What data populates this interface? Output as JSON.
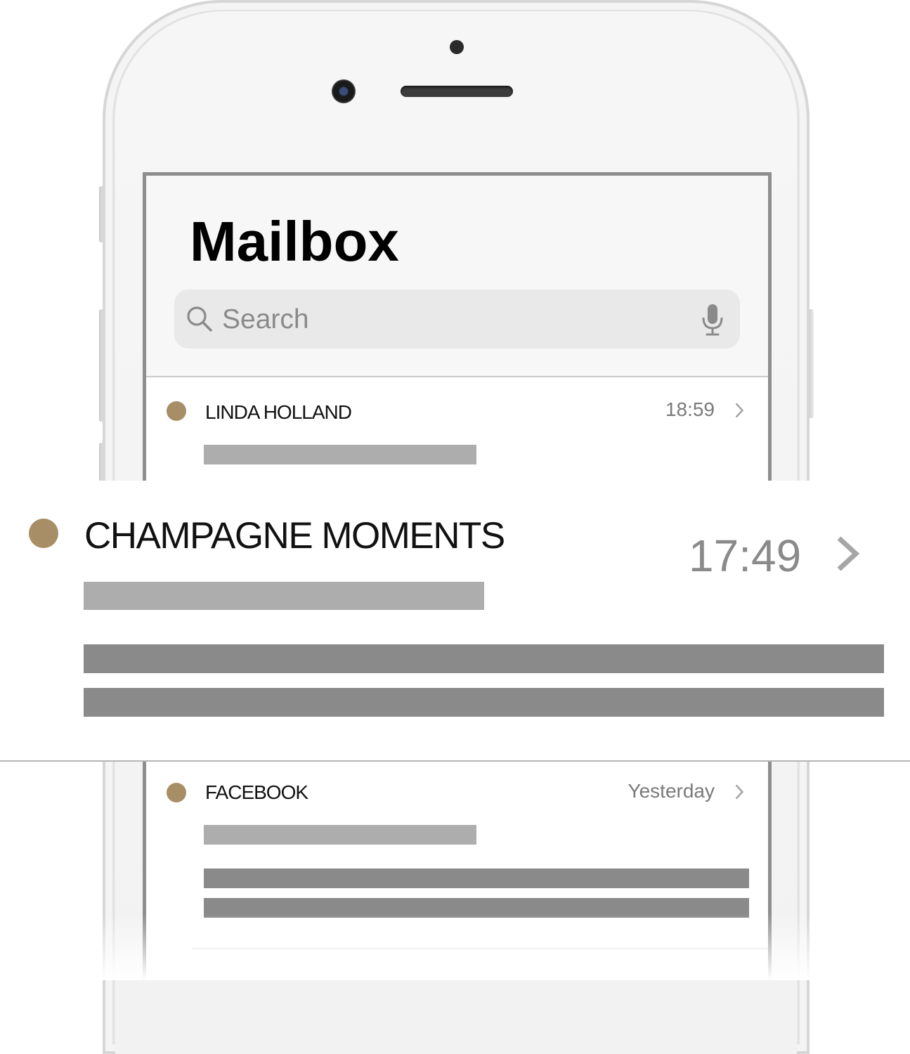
{
  "app": {
    "title": "Mailbox"
  },
  "search": {
    "placeholder": "Search",
    "icon": "magnifier",
    "voice_icon": "microphone"
  },
  "accent_color": "#a88e66",
  "messages": [
    {
      "sender": "LINDA HOLLAND",
      "time": "18:59",
      "unread": true
    },
    {
      "sender": "CHAMPAGNE MOMENTS",
      "time": "17:49",
      "unread": true,
      "magnified": true
    },
    {
      "sender": "FACEBOOK",
      "time": "Yesterday",
      "unread": true
    }
  ]
}
